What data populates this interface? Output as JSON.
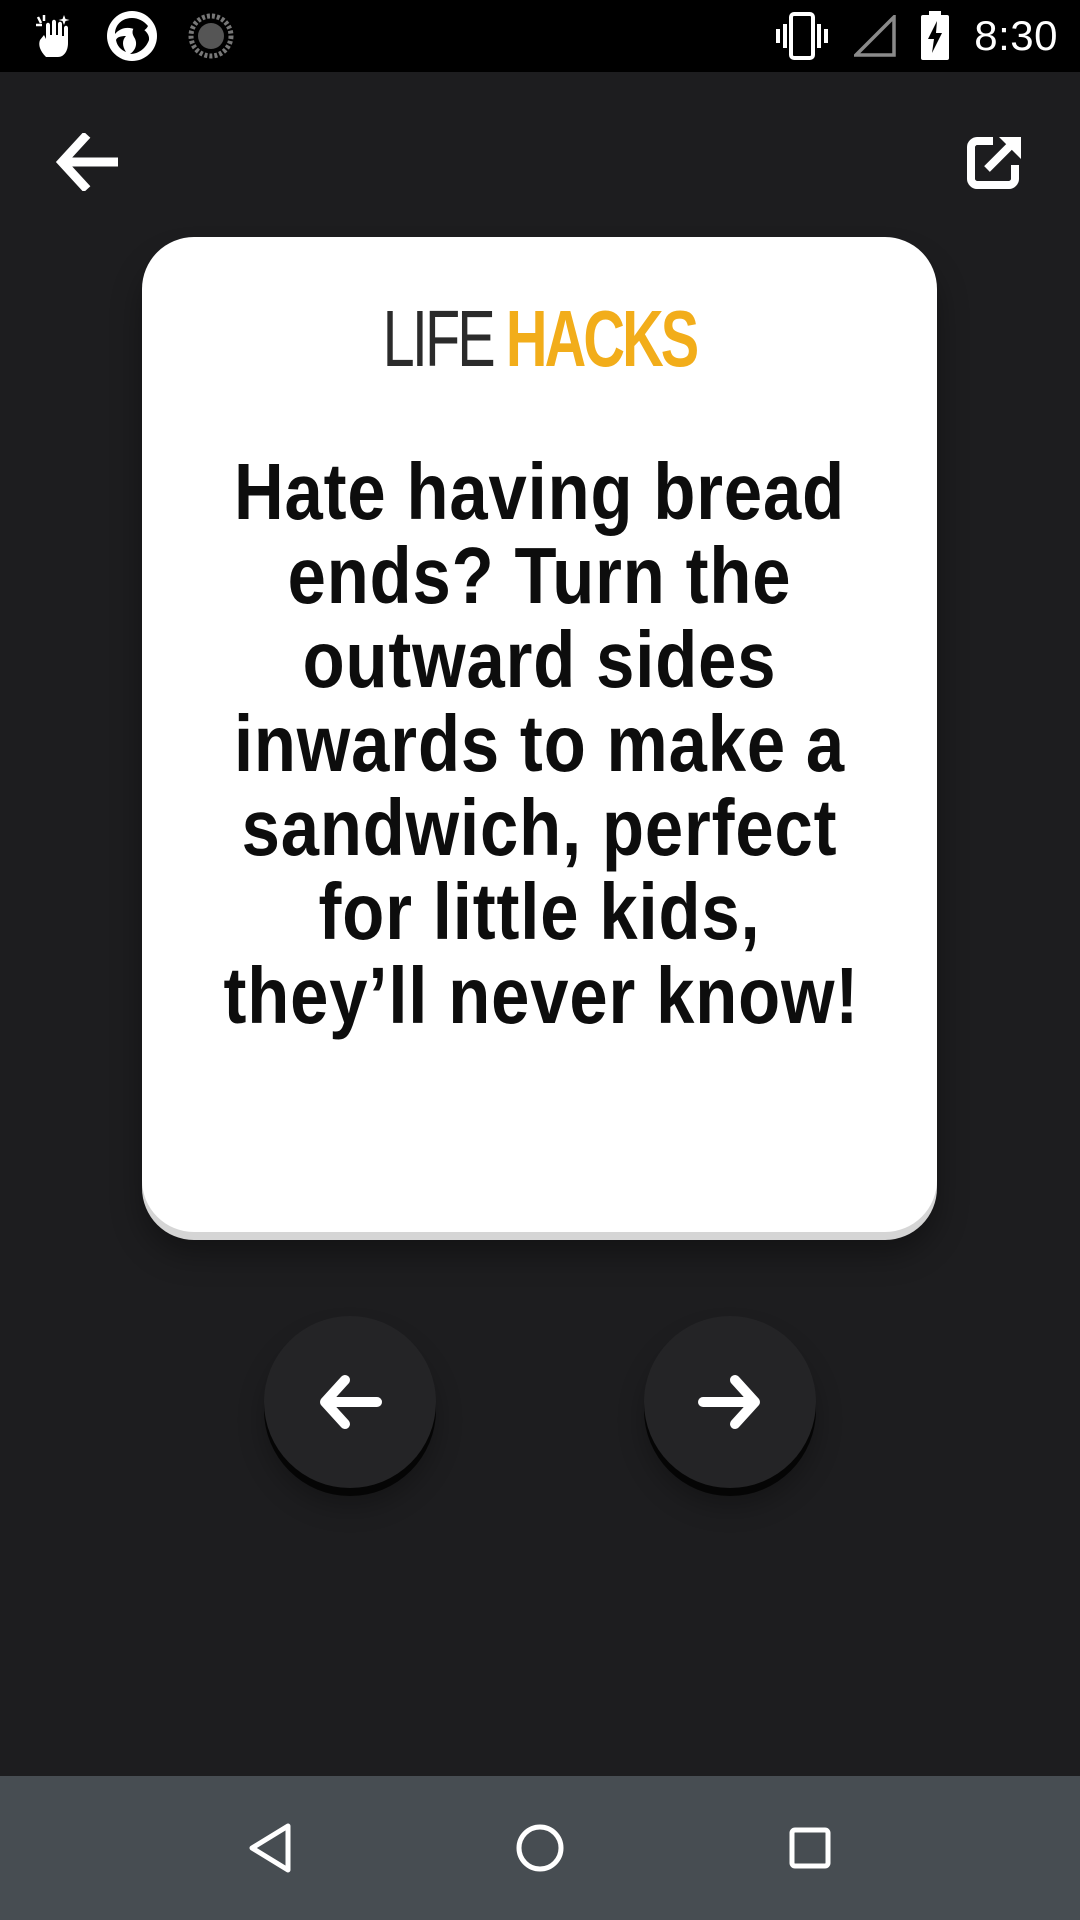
{
  "status_bar": {
    "time": "8:30",
    "left_icons": [
      "touch-gesture-icon",
      "aperture-app-icon",
      "loading-spinner-icon"
    ],
    "right_icons": [
      "vibrate-icon",
      "no-signal-icon",
      "battery-charging-icon"
    ]
  },
  "toolbar": {
    "back_icon": "arrow-left-icon",
    "share_icon": "share-external-icon"
  },
  "card": {
    "logo_part1": "LIFE",
    "logo_part2": "HACKS",
    "text_lines": [
      "Hate having bread",
      "ends? Turn the",
      "outward sides",
      "inwards to make a",
      "sandwich, perfect",
      "for little kids,",
      "they’ll never know!"
    ]
  },
  "navigation": {
    "prev_icon": "arrow-left-icon",
    "next_icon": "arrow-right-icon"
  },
  "system_nav": {
    "back_icon": "triangle-back-icon",
    "home_icon": "circle-home-icon",
    "recents_icon": "square-recents-icon"
  },
  "colors": {
    "background": "#1d1d1f",
    "card": "#ffffff",
    "accent": "#f2ad1a",
    "nav_bar": "#474d52"
  }
}
